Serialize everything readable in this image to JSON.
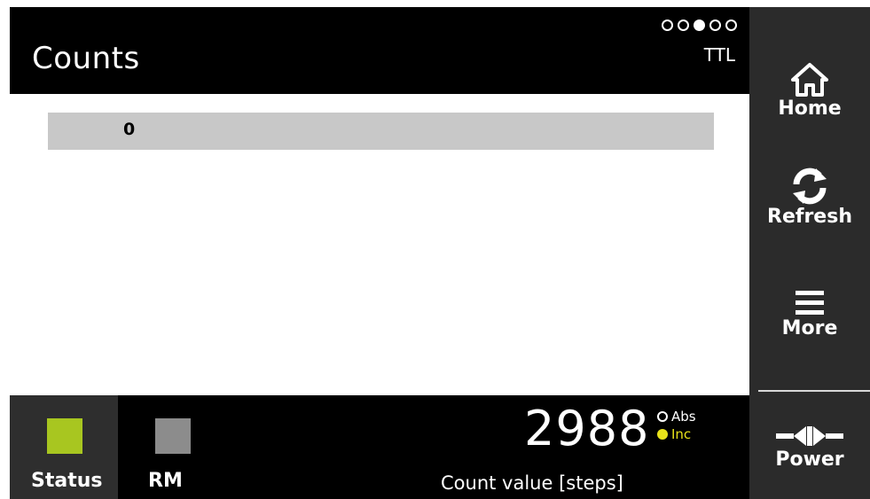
{
  "header": {
    "title": "Counts",
    "mode": "TTL",
    "pager": {
      "total": 5,
      "active_index": 2
    }
  },
  "main": {
    "value_field": "0"
  },
  "bottom": {
    "tabs": [
      {
        "label": "Status",
        "color": "#a8c620",
        "selected": true
      },
      {
        "label": "RM",
        "color": "#8c8c8c",
        "selected": false
      }
    ],
    "count_value": "2988",
    "count_caption": "Count value [steps]",
    "reference": {
      "abs_label": "Abs",
      "inc_label": "Inc",
      "active": "Inc"
    }
  },
  "sidebar": {
    "home_label": "Home",
    "refresh_label": "Refresh",
    "more_label": "More",
    "power_label": "Power"
  },
  "colors": {
    "background": "#000000",
    "sidebar": "#2b2b2b",
    "value_bar": "#c8c8c8",
    "inc_indicator": "#e8e21a"
  }
}
